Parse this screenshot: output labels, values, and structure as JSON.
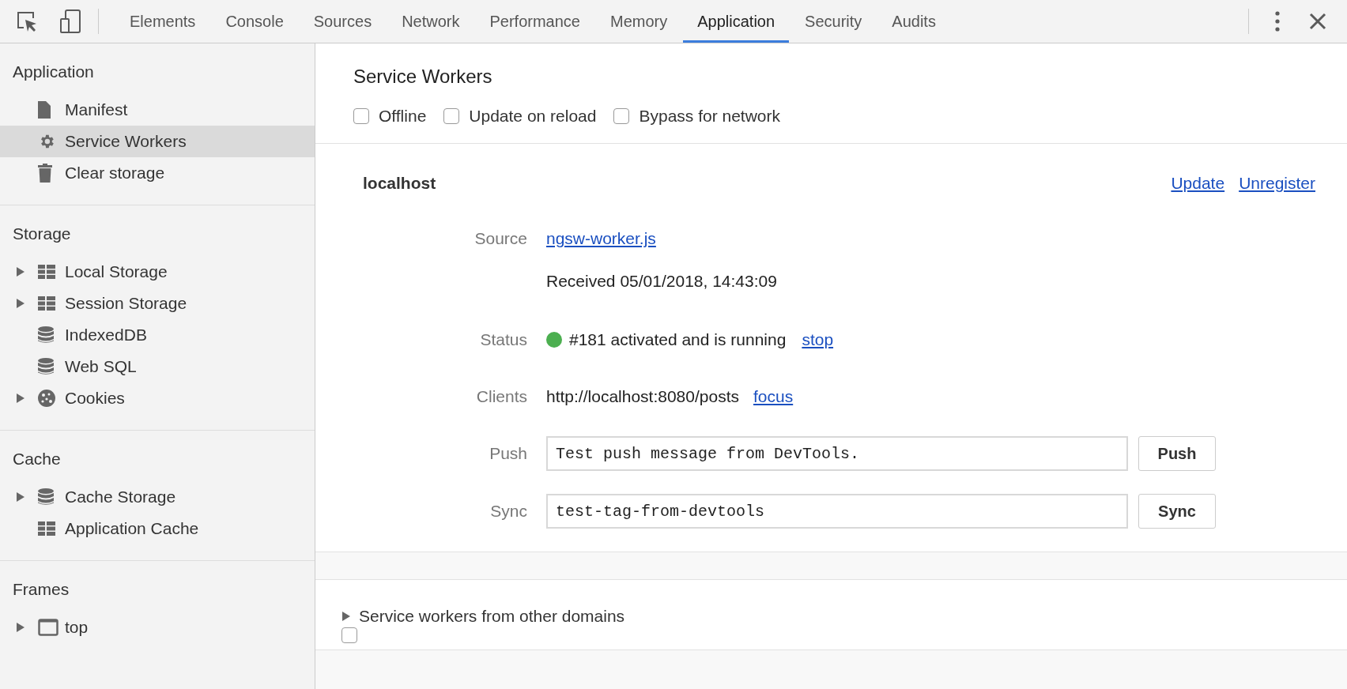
{
  "toolbar": {
    "tabs": [
      {
        "label": "Elements",
        "selected": false
      },
      {
        "label": "Console",
        "selected": false
      },
      {
        "label": "Sources",
        "selected": false
      },
      {
        "label": "Network",
        "selected": false
      },
      {
        "label": "Performance",
        "selected": false
      },
      {
        "label": "Memory",
        "selected": false
      },
      {
        "label": "Application",
        "selected": true
      },
      {
        "label": "Security",
        "selected": false
      },
      {
        "label": "Audits",
        "selected": false
      }
    ]
  },
  "sidebar": {
    "sections": [
      {
        "title": "Application",
        "items": [
          {
            "label": "Manifest",
            "kind": "file",
            "expandable": false,
            "selected": false
          },
          {
            "label": "Service Workers",
            "kind": "gear",
            "expandable": false,
            "selected": true
          },
          {
            "label": "Clear storage",
            "kind": "trash",
            "expandable": false,
            "selected": false
          }
        ]
      },
      {
        "title": "Storage",
        "items": [
          {
            "label": "Local Storage",
            "kind": "grid",
            "expandable": true,
            "selected": false
          },
          {
            "label": "Session Storage",
            "kind": "grid",
            "expandable": true,
            "selected": false
          },
          {
            "label": "IndexedDB",
            "kind": "database",
            "expandable": false,
            "selected": false
          },
          {
            "label": "Web SQL",
            "kind": "database",
            "expandable": false,
            "selected": false
          },
          {
            "label": "Cookies",
            "kind": "cookie",
            "expandable": true,
            "selected": false
          }
        ]
      },
      {
        "title": "Cache",
        "items": [
          {
            "label": "Cache Storage",
            "kind": "database",
            "expandable": true,
            "selected": false
          },
          {
            "label": "Application Cache",
            "kind": "grid",
            "expandable": false,
            "selected": false
          }
        ]
      },
      {
        "title": "Frames",
        "items": [
          {
            "label": "top",
            "kind": "frame",
            "expandable": true,
            "selected": false
          }
        ]
      }
    ]
  },
  "main": {
    "title": "Service Workers",
    "options": [
      {
        "label": "Offline",
        "checked": false
      },
      {
        "label": "Update on reload",
        "checked": false
      },
      {
        "label": "Bypass for network",
        "checked": false
      }
    ]
  },
  "worker": {
    "scope": "localhost",
    "actions": [
      "Update",
      "Unregister"
    ],
    "source": {
      "label": "Source",
      "link": "ngsw-worker.js",
      "received": "Received 05/01/2018, 14:43:09"
    },
    "status": {
      "label": "Status",
      "running": true,
      "text": "#181 activated and is running",
      "action": "stop"
    },
    "clients": {
      "label": "Clients",
      "url": "http://localhost:8080/posts",
      "action": "focus"
    },
    "push": {
      "label": "Push",
      "value": "Test push message from DevTools.",
      "button": "Push"
    },
    "sync": {
      "label": "Sync",
      "value": "test-tag-from-devtools",
      "button": "Sync"
    }
  },
  "other_domains": {
    "label": "Service workers from other domains",
    "expanded": false,
    "checked": false
  }
}
